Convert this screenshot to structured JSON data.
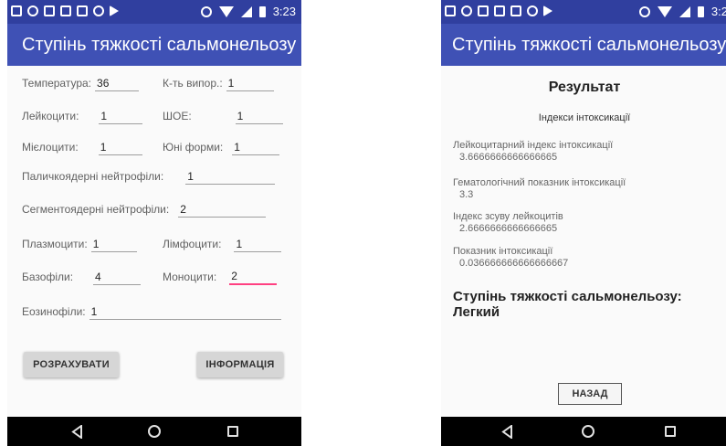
{
  "status_bar": {
    "time_left": "3:23",
    "time_right": "3:2"
  },
  "app_title": "Ступінь тяжкості сальмонельозу",
  "input_form": {
    "fields": {
      "temperature": {
        "label": "Температура:",
        "value": "36"
      },
      "evap_coef": {
        "label": "К-ть випор.:",
        "value": "1"
      },
      "leukocytes": {
        "label": "Лейкоцити:",
        "value": "1"
      },
      "esr": {
        "label": "ШОЕ:",
        "value": "1"
      },
      "myelocytes": {
        "label": "Мієлоцити:",
        "value": "1"
      },
      "young_forms": {
        "label": "Юні форми:",
        "value": "1"
      },
      "band_neutrophils": {
        "label": "Паличкоядерні нейтрофіли:",
        "value": "1"
      },
      "segmented_neutrophils": {
        "label": "Сегментоядерні нейтрофіли:",
        "value": "2"
      },
      "plasmocytes": {
        "label": "Плазмоцити:",
        "value": "1"
      },
      "lymphocytes": {
        "label": "Лімфоцити:",
        "value": "1"
      },
      "basophils": {
        "label": "Базофіли:",
        "value": "4"
      },
      "monocytes": {
        "label": "Моноцити:",
        "value": "2"
      },
      "eosinophils": {
        "label": "Еозинофіли:",
        "value": "1"
      }
    },
    "buttons": {
      "calculate": "РОЗРАХУВАТИ",
      "info": "ІНФОРМАЦІЯ"
    }
  },
  "result_screen": {
    "title": "Результат",
    "subtitle": "Індекси інтоксикації",
    "indices": [
      {
        "label": "Лейкоцитарний індекс інтоксикації",
        "value": "3.6666666666666665"
      },
      {
        "label": "Гематологічний показник інтоксикації",
        "value": "3.3"
      },
      {
        "label": "Індекс зсуву лейкоцитів",
        "value": "2.6666666666666665"
      },
      {
        "label": "Показник інтоксикації",
        "value": "0.036666666666666667"
      }
    ],
    "result_text": "Ступінь тяжкості сальмонельозу: Легкий",
    "back_button": "НАЗАД"
  }
}
